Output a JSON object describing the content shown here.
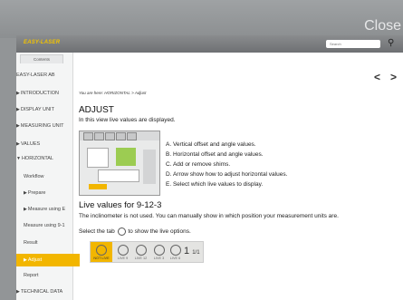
{
  "window": {
    "close_label": "Close"
  },
  "header": {
    "logo_text": "EASY-LASER",
    "search_placeholder": "Search",
    "search_icon": "magnifier-icon"
  },
  "sidebar": {
    "tab_label": "Contents",
    "items": [
      {
        "label": "EASY-LASER AB",
        "caret": ""
      },
      {
        "label": "INTRODUCTION",
        "caret": "▶"
      },
      {
        "label": "DISPLAY UNIT",
        "caret": "▶"
      },
      {
        "label": "MEASURING UNIT",
        "caret": "▶"
      },
      {
        "label": "VALUES",
        "caret": "▶"
      },
      {
        "label": "HORIZONTAL",
        "caret": "▼"
      },
      {
        "label": "Workflow",
        "caret": ""
      },
      {
        "label": "Prepare",
        "caret": "▶"
      },
      {
        "label": "Measure using E",
        "caret": "▶"
      },
      {
        "label": "Measure using 9-1",
        "caret": ""
      },
      {
        "label": "Result",
        "caret": ""
      },
      {
        "label": "Adjust",
        "caret": "▶"
      },
      {
        "label": "Report",
        "caret": ""
      },
      {
        "label": "TECHNICAL DATA",
        "caret": "▶"
      }
    ]
  },
  "main": {
    "nav_prev": "<",
    "nav_next": ">",
    "breadcrumb": "You are here: HORIZONTAL > Adjust",
    "title": "ADJUST",
    "intro": "In this view live values are displayed.",
    "list": [
      "A.  Vertical offset and angle values.",
      "B.  Horizontal offset and angle values.",
      "C.  Add or remove shims.",
      "D.  Arrow show how to adjust horizontal values.",
      "E.  Select which live values to display."
    ],
    "live_heading": "Live values for 9-12-3",
    "live_p1": "The inclinometer is not used. You can manually show in which position your measurement units are.",
    "live_p2_before": "Select the tab",
    "live_p2_after": "to show the live options.",
    "live_options": [
      "NOT LIVE",
      "LIVE 9",
      "LIVE 12",
      "LIVE 3",
      "LIVE 6"
    ],
    "live_number": "1",
    "live_fraction": "1/1"
  }
}
